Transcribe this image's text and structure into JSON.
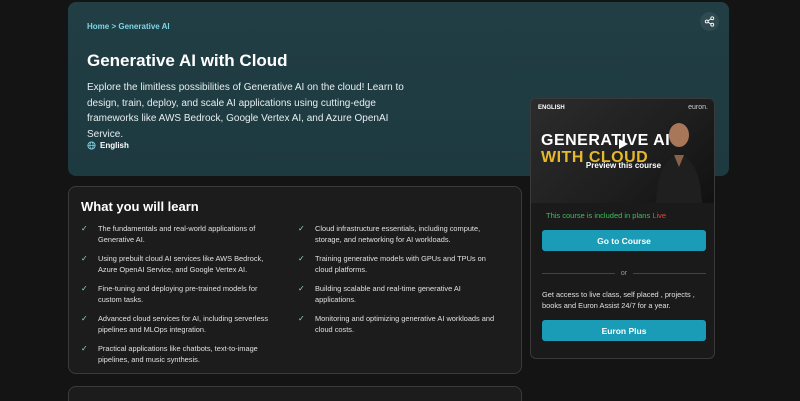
{
  "hero": {
    "breadcrumb_home": "Home",
    "breadcrumb_sep": ">",
    "breadcrumb_current": "Generative AI",
    "title": "Generative AI with Cloud",
    "description": "Explore the limitless possibilities of Generative AI on the cloud! Learn to design, train, deploy, and scale AI applications using cutting-edge frameworks like AWS Bedrock, Google Vertex AI, and Azure OpenAI Service.",
    "language": "English",
    "share_icon": "share-icon"
  },
  "learn": {
    "title": "What you will learn",
    "left_items": [
      "The fundamentals and real-world applications of Generative AI.",
      "Using prebuilt cloud AI services like AWS Bedrock, Azure OpenAI Service, and Google Vertex AI.",
      "Fine-tuning and deploying pre-trained models for custom tasks.",
      "Advanced cloud services for AI, including serverless pipelines and MLOps integration.",
      "Practical applications like chatbots, text-to-image pipelines, and music synthesis."
    ],
    "right_items": [
      "Cloud infrastructure essentials, including compute, storage, and networking for AI workloads.",
      "Training generative models with GPUs and TPUs on cloud platforms.",
      "Building scalable and real-time generative AI applications.",
      "Monitoring and optimizing generative AI workloads and cloud costs."
    ]
  },
  "card": {
    "preview_language": "ENGLISH",
    "preview_brand": "euron.",
    "preview_line1": "GENERATIVE AI",
    "preview_line2": "WITH CLOUD",
    "preview_label": "Preview this course",
    "plan_note": "This course is included in plans",
    "plan_live": "Live",
    "go_to_course": "Go to Course",
    "or_label": "or",
    "access_text": "Get access to live class, self placed , projects , books and Euron Assist 24/7 for a year.",
    "euron_plus": "Euron Plus"
  },
  "colors": {
    "accent": "#1b9cb6",
    "hero_bg": "#213e44",
    "live": "#e04a3f",
    "included": "#3fbf5e"
  }
}
